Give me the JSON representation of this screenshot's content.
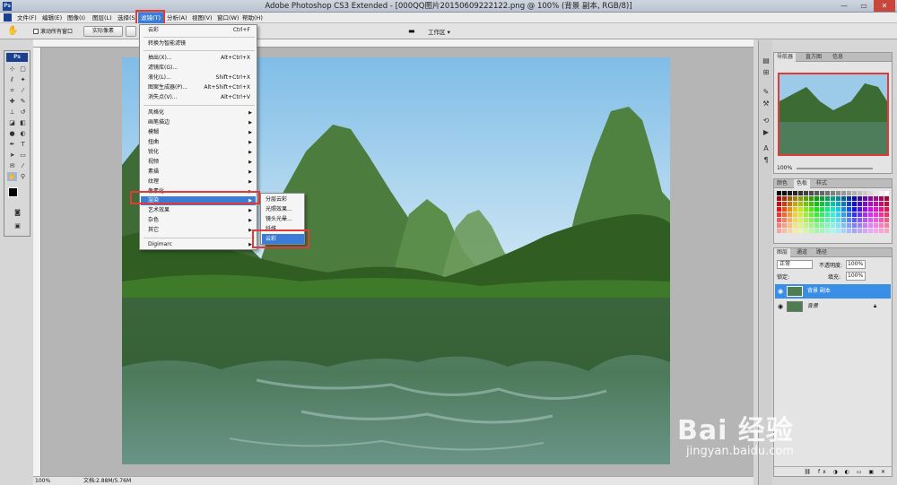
{
  "window": {
    "title": "Adobe Photoshop CS3 Extended - [000QQ图片20150609222122.png @ 100% (背景 副本, RGB/8)]",
    "app_icon": "Ps"
  },
  "menubar": [
    "文件(F)",
    "编辑(E)",
    "图像(I)",
    "图层(L)",
    "选择(S)",
    "滤镜(T)",
    "分析(A)",
    "视图(V)",
    "窗口(W)",
    "帮助(H)"
  ],
  "options": {
    "scroll_all_windows": "滚动所有窗口",
    "actual_pixels": "实际像素",
    "workspace": "工作区 ▾"
  },
  "filter_menu": {
    "top": [
      {
        "label": "云彩",
        "shortcut": "Ctrl+F"
      },
      {
        "label": "转换为智能滤镜",
        "shortcut": ""
      }
    ],
    "group2": [
      {
        "label": "抽出(X)...",
        "shortcut": "Alt+Ctrl+X"
      },
      {
        "label": "滤镜库(G)...",
        "shortcut": ""
      },
      {
        "label": "液化(L)...",
        "shortcut": "Shift+Ctrl+X"
      },
      {
        "label": "图案生成器(P)...",
        "shortcut": "Alt+Shift+Ctrl+X"
      },
      {
        "label": "消失点(V)...",
        "shortcut": "Alt+Ctrl+V"
      }
    ],
    "group3": [
      "风格化",
      "画笔描边",
      "模糊",
      "扭曲",
      "锐化",
      "视频",
      "素描",
      "纹理",
      "像素化",
      "渲染",
      "艺术效果",
      "杂色",
      "其它"
    ],
    "highlighted": "渲染",
    "bottom": "Digimarc"
  },
  "render_submenu": {
    "items": [
      "分层云彩",
      "光照效果...",
      "镜头光晕...",
      "纤维",
      "云彩"
    ],
    "highlighted": "云彩"
  },
  "status": {
    "zoom": "100%",
    "doc": "文档:2.88M/5.76M"
  },
  "navigator": {
    "tabs": [
      "导航器",
      "直方图",
      "信息"
    ],
    "zoom": "100%"
  },
  "swatches": {
    "tabs": [
      "颜色",
      "色板",
      "样式"
    ]
  },
  "layers": {
    "tabs": [
      "图层",
      "通道",
      "路径"
    ],
    "blend_mode": "正常",
    "opacity_label": "不透明度:",
    "opacity": "100%",
    "lock_label": "锁定:",
    "fill_label": "填充:",
    "fill": "100%",
    "items": [
      "背景 副本",
      "背景"
    ]
  },
  "watermark": {
    "brand": "Bai 经验",
    "url": "jingyan.baidu.com"
  },
  "colors": {
    "highlight": "#3a7cd8",
    "annotation": "#e13a3a"
  }
}
